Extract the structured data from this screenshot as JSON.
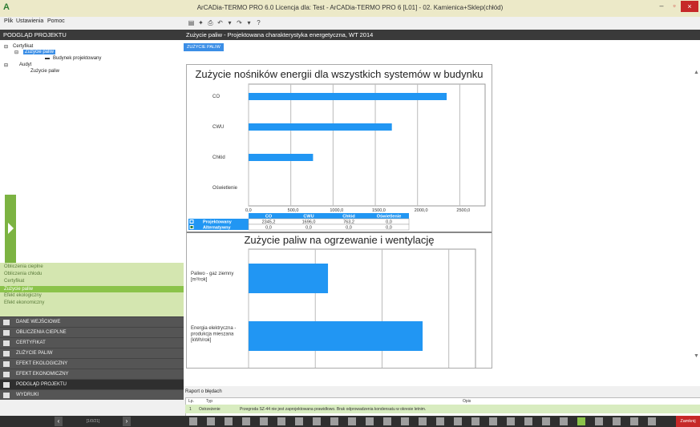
{
  "window": {
    "title": "ArCADia-TERMO PRO 6.0 Licencja dla: Test - ArCADia-TERMO PRO 6 [L01] - 02. Kamienica+Sklep(chłód)",
    "min": "–",
    "max": "▫",
    "close": "×"
  },
  "menu": [
    "Plik",
    "Ustawienia",
    "Pomoc"
  ],
  "left_panel": {
    "header": "PODGLĄD PROJEKTU",
    "tree": [
      {
        "label": "Certyfikat",
        "sign": "⊟"
      },
      {
        "label": "Zużycie paliw",
        "sign": "⊟"
      },
      {
        "label": "Budynek projektowany",
        "sign": ""
      },
      {
        "label": "Audyt",
        "sign": "⊟"
      },
      {
        "label": "Zużycie paliw",
        "sign": ""
      }
    ],
    "submenu": [
      "Obliczenia cieplne",
      "Obliczenia chłodu",
      "Certyfikat",
      "Zużycie paliw",
      "Efekt ekologiczny",
      "Efekt ekonomiczny"
    ],
    "sections": [
      "DANE WEJŚCIOWE",
      "OBLICZENIA CIEPLNE",
      "CERTYFIKAT",
      "ZUŻYCIE PALIW",
      "EFEKT EKOLOGICZNY",
      "EFEKT EKONOMICZNY",
      "PODGLĄD PROJEKTU",
      "WYDRUKI"
    ],
    "pager": {
      "prev": "‹",
      "next": "›",
      "text": "[1/0/21]"
    }
  },
  "toolbar_icons": [
    "save-icon",
    "print-icon",
    "preview-icon",
    "undo-icon",
    "filter-icon",
    "redo-icon",
    "filter2-icon",
    "help-icon"
  ],
  "toolbar_glyphs": [
    "▤",
    "✦",
    "⎙",
    "↶",
    "▾",
    "↷",
    "▾",
    "?"
  ],
  "content": {
    "header": "Zużycie paliw - Projektowana charakterystyka energetyczna, WT 2014",
    "tab": "ZUŻYCIE PALIW",
    "scroll_up": "▲",
    "scroll_down": "▼"
  },
  "error_report": {
    "title": "Raport o błędach",
    "col_lp": "Lp.",
    "col_typ": "Typ",
    "col_opis": "Opis",
    "row": {
      "lp": "1",
      "typ": "Ostrzeżenie",
      "opis": "Przegroda SZ-44 nie jest zaprojektowana prawidłowo. Brak odprowadzenia kondensatu w okresie letnim."
    }
  },
  "close_label": "Zamknij",
  "colors": {
    "bar": "#2196f3",
    "accent_green": "#8bc34a",
    "header_dark": "#3a3a3a",
    "red": "#c62828"
  },
  "chart_data": [
    {
      "type": "bar",
      "orientation": "horizontal",
      "title": "Zużycie nośników energii dla wszystkich systemów w budynku",
      "categories": [
        "CO",
        "CWU",
        "Chłód",
        "Oświetlenie"
      ],
      "xticks": [
        "0,0",
        "500,0",
        "1000,0",
        "1500,0",
        "2000,0",
        "2500,0"
      ],
      "xlim": [
        0,
        2800
      ],
      "series": [
        {
          "name": "Projektowany",
          "values": [
            2345.2,
            1696.0,
            763.2,
            0.0
          ],
          "labels": [
            "2345,2",
            "1696,0",
            "763,2",
            "0,0"
          ],
          "color": "#2196f3"
        },
        {
          "name": "Alternatywny",
          "values": [
            0.0,
            0.0,
            0.0,
            0.0
          ],
          "labels": [
            "0,0",
            "0,0",
            "0,0",
            "0,0"
          ],
          "color": "#2e7d32"
        }
      ],
      "table_headers": [
        "CO",
        "CWU",
        "Chłód",
        "Oświetlenie"
      ]
    },
    {
      "type": "bar",
      "orientation": "horizontal",
      "title": "Zużycie paliw na ogrzewanie i wentylację",
      "categories": [
        "Paliwo - gaz ziemny [m³/rok]",
        "Energia elektryczna - produkcja mieszana [kWh/rok]"
      ],
      "category_lines": [
        [
          "Paliwo - gaz ziemny",
          "[m³/rok]"
        ],
        [
          "Energia elektryczna -",
          "produkcja mieszana",
          "[kWh/rok]"
        ]
      ],
      "xticks": [
        "0,0",
        "500,0",
        "1000,0",
        "1500,0"
      ],
      "xlim": [
        0,
        1700
      ],
      "series": [
        {
          "values": [
            595,
            1304
          ],
          "color": "#2196f3"
        }
      ]
    }
  ]
}
